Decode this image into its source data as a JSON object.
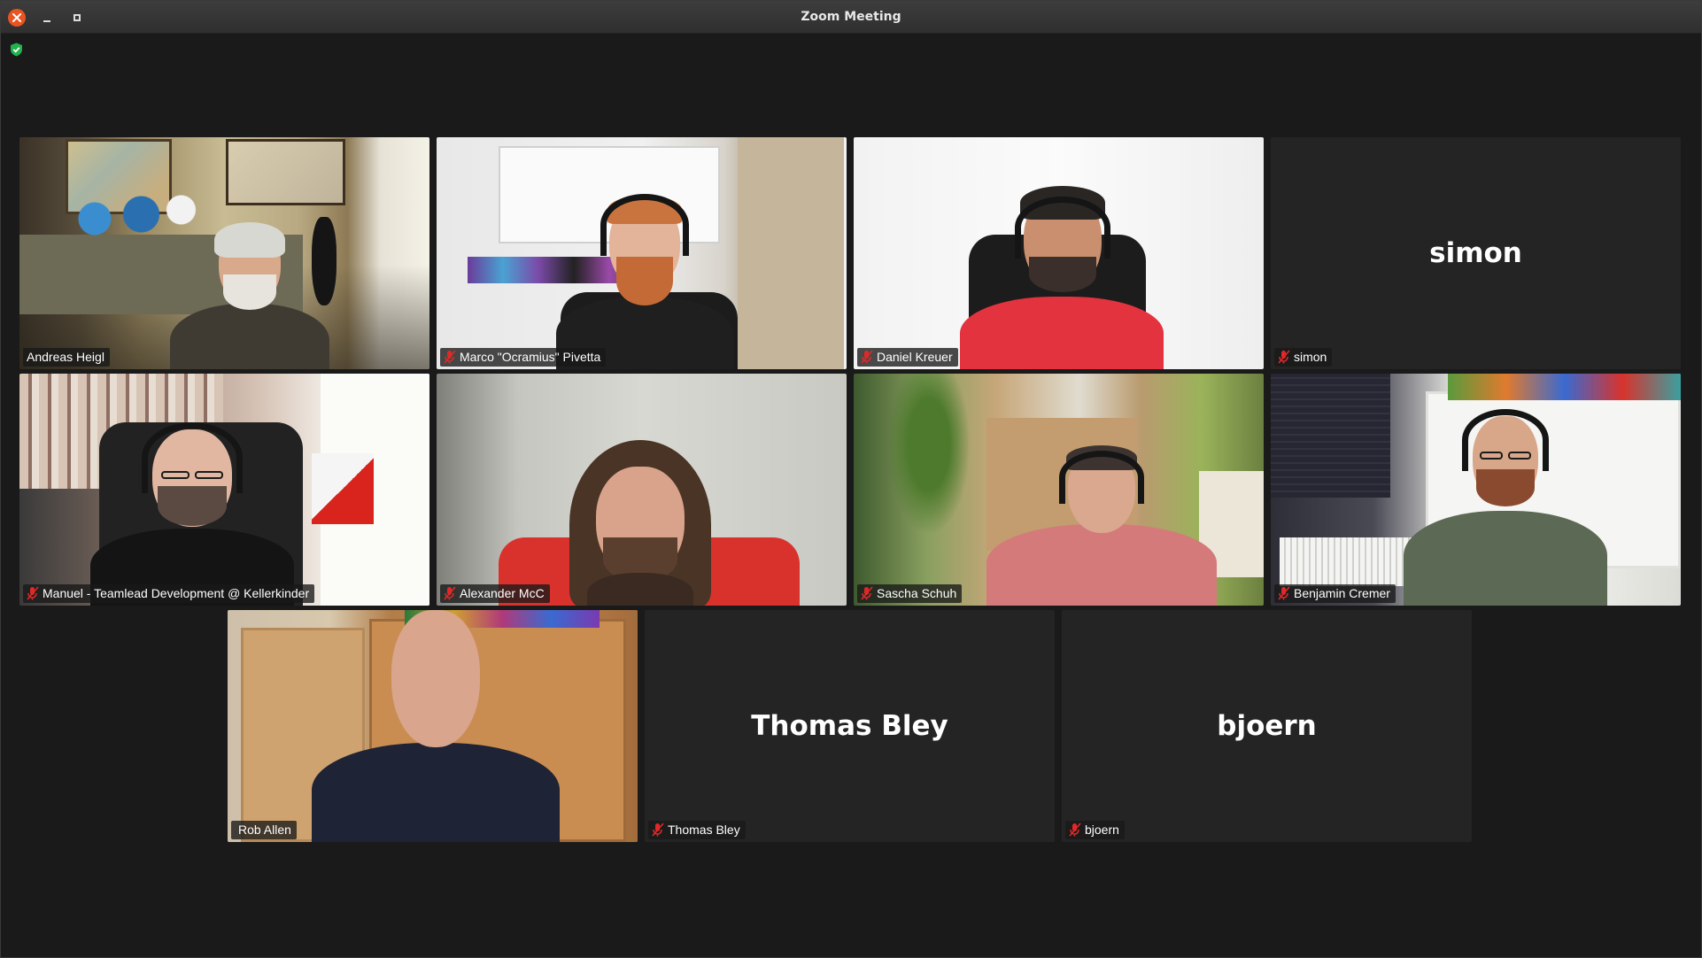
{
  "window": {
    "title": "Zoom Meeting"
  },
  "participants": [
    {
      "display_name": "Andreas Heigl",
      "label": "Andreas Heigl",
      "muted": false,
      "video": true
    },
    {
      "display_name": "Marco \"Ocramius\" Pivetta",
      "label": "Marco \"Ocramius\" Pivetta",
      "muted": true,
      "video": true
    },
    {
      "display_name": "Daniel Kreuer",
      "label": "Daniel Kreuer",
      "muted": true,
      "video": true
    },
    {
      "display_name": "simon",
      "label": "simon",
      "muted": true,
      "video": false
    },
    {
      "display_name": "Manuel - Teamlead Development @ Kellerkinder",
      "label": "Manuel - Teamlead Development @ Kellerkinder",
      "muted": true,
      "video": true
    },
    {
      "display_name": "Alexander McC",
      "label": "Alexander McC",
      "muted": true,
      "video": true
    },
    {
      "display_name": "Sascha Schuh",
      "label": "Sascha Schuh",
      "muted": true,
      "video": true
    },
    {
      "display_name": "Benjamin Cremer",
      "label": "Benjamin Cremer",
      "muted": true,
      "video": true
    },
    {
      "display_name": "Rob Allen",
      "label": "Rob Allen",
      "muted": false,
      "video": true,
      "active_speaker": true
    },
    {
      "display_name": "Thomas Bley",
      "label": "Thomas Bley",
      "muted": true,
      "video": false
    },
    {
      "display_name": "bjoern",
      "label": "bjoern",
      "muted": true,
      "video": false
    }
  ],
  "colors": {
    "background": "#1a1a1a",
    "tile": "#242424",
    "active_speaker": "#23d959",
    "muted_icon": "#e02828",
    "close_button": "#e95420",
    "shield": "#23b14d"
  },
  "icons": {
    "security": "shield-check-icon",
    "muted": "mic-muted-icon",
    "close": "close-icon",
    "minimize": "minimize-icon",
    "maximize": "maximize-icon"
  }
}
